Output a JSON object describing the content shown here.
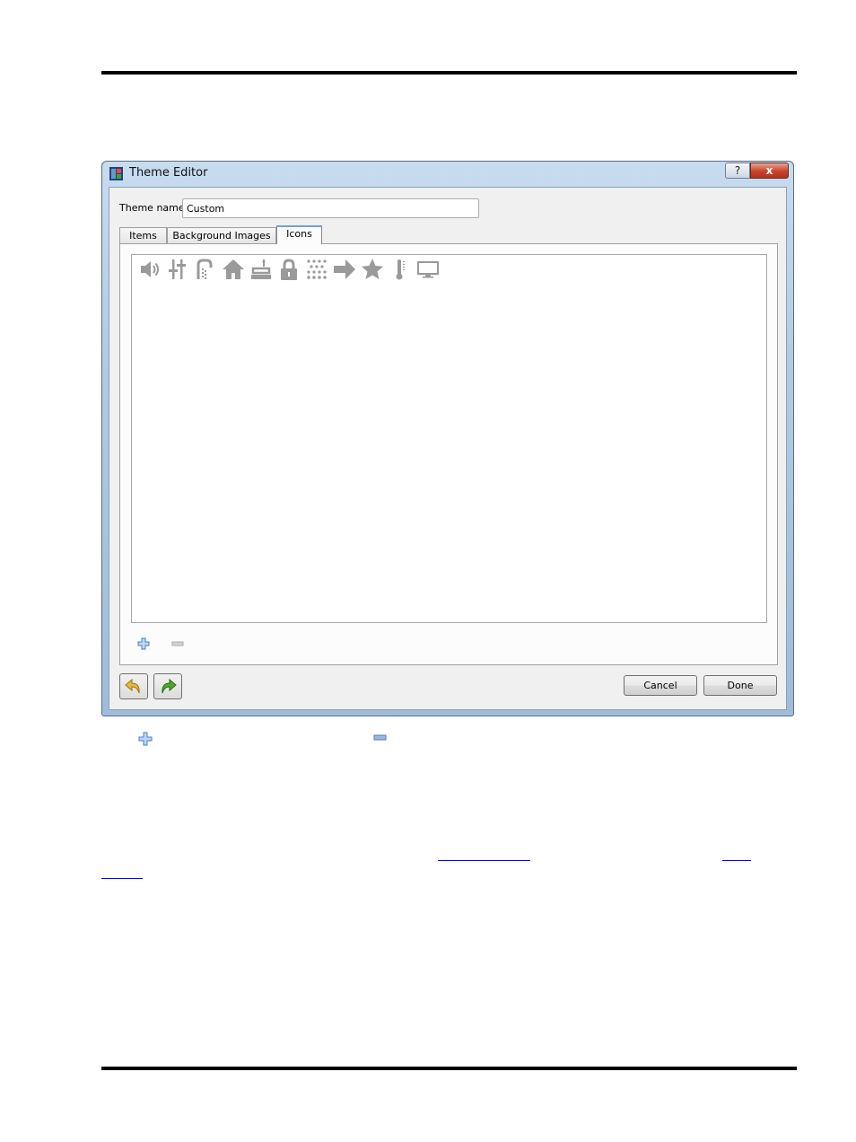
{
  "window": {
    "title": "Theme Editor",
    "help_glyph": "?",
    "close_glyph": "x"
  },
  "form": {
    "theme_name_label": "Theme name",
    "theme_name_value": "Custom"
  },
  "tabs": [
    {
      "label": "Items",
      "active": false
    },
    {
      "label": "Background Images",
      "active": false
    },
    {
      "label": "Icons",
      "active": true
    }
  ],
  "icons": [
    "speaker-icon",
    "sliders-icon",
    "faucet-icon",
    "house-icon",
    "lamp-icon",
    "lock-icon",
    "dots-grid-icon",
    "arrow-right-icon",
    "star-icon",
    "thermometer-icon",
    "television-icon"
  ],
  "buttons": {
    "cancel": "Cancel",
    "done": "Done"
  },
  "colors": {
    "icon_gray": "#9a9a9a",
    "accent_blue": "#5b8fd1",
    "undo_yellow": "#e5b93b",
    "redo_green": "#4caa2a"
  }
}
